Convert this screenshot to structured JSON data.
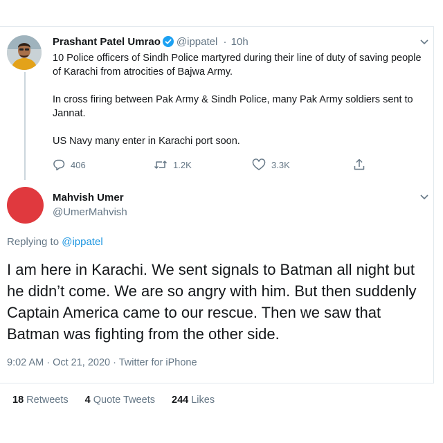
{
  "original_tweet": {
    "author_name": "Prashant Patel Umrao",
    "handle": "@ippatel",
    "separator": "·",
    "time_ago": "10h",
    "verified": true,
    "paragraphs": [
      "10 Police officers of Sindh Police martyred during their line of duty of saving people of Karachi from atrocities of Bajwa Army.",
      "In cross firing between Pak Army & Sindh Police, many Pak Army soldiers sent to Jannat.",
      "US Navy many enter in Karachi port soon."
    ],
    "actions": {
      "reply_count": "406",
      "retweet_count": "1.2K",
      "like_count": "3.3K"
    }
  },
  "reply_tweet": {
    "author_name": "Mahvish Umer",
    "handle": "@UmerMahvish",
    "replying_prefix": "Replying to",
    "replying_to": "@ippatel",
    "text": "I am here in Karachi. We sent signals to Batman all night but he didn’t come. We are so angry with him. But then suddenly Captain America came to our rescue. Then we saw that Batman was fighting from the other side.",
    "meta": "9:02 AM · Oct 21, 2020 · Twitter for iPhone",
    "stats": {
      "retweets_count": "18",
      "retweets_label": "Retweets",
      "quote_tweets_count": "4",
      "quote_tweets_label": "Quote Tweets",
      "likes_count": "244",
      "likes_label": "Likes"
    },
    "avatar_color": "#e0393e"
  },
  "icons": {
    "verified": "verified-badge-icon",
    "reply": "reply-icon",
    "retweet": "retweet-icon",
    "like": "heart-icon",
    "share": "share-icon",
    "menu": "chevron-down-icon"
  },
  "colors": {
    "accent": "#1da1f2",
    "link": "#1b95e0",
    "muted": "#657786"
  }
}
